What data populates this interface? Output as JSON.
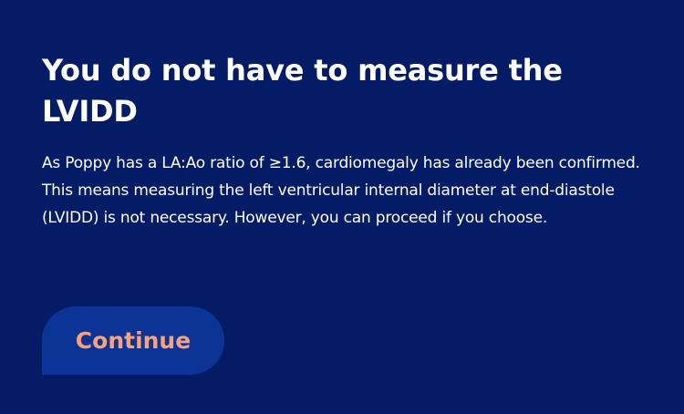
{
  "colors": {
    "background": "#041b66",
    "text": "#ffffff",
    "button_background": "#0c3396",
    "button_text": "#f6a37d"
  },
  "content": {
    "title": "You do not have to measure the LVIDD",
    "message": "As Poppy has a LA:Ao ratio of ≥1.6, cardiomegaly has already been confirmed. This means measuring the left ventricular internal diameter at end-diastole (LVIDD) is not necessary. However, you can proceed if you choose.",
    "continue_label": "Continue"
  }
}
